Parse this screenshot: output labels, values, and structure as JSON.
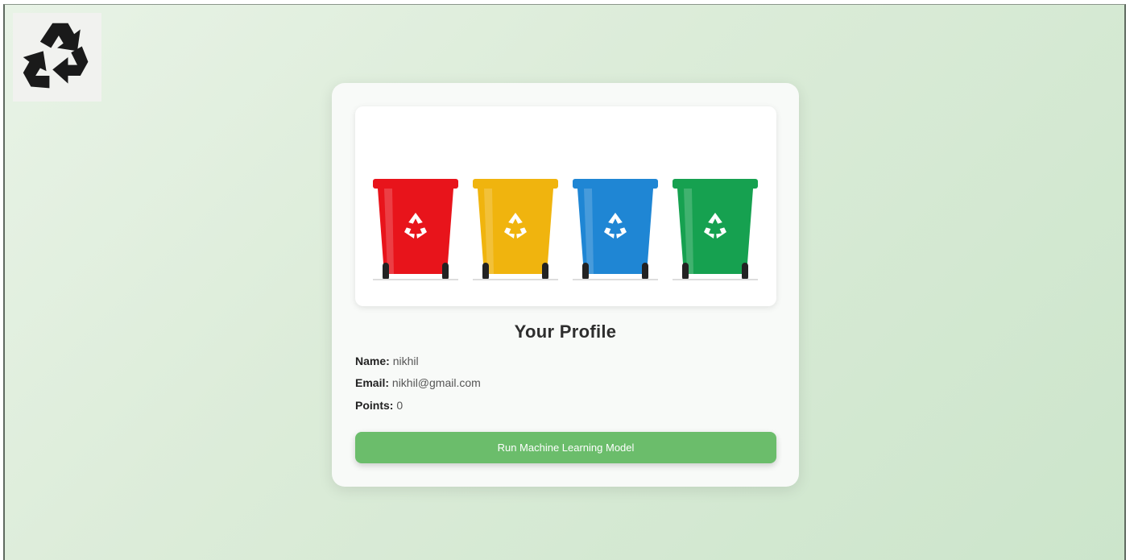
{
  "logo": {
    "icon": "recycle-icon"
  },
  "hero": {
    "bins": [
      {
        "color": "#e8141b",
        "icon": "recycle-icon"
      },
      {
        "color": "#f0b40e",
        "icon": "recycle-icon"
      },
      {
        "color": "#1f86d4",
        "icon": "recycle-icon"
      },
      {
        "color": "#16a150",
        "icon": "recycle-icon"
      }
    ]
  },
  "profile": {
    "title": "Your Profile",
    "name_label": "Name:",
    "name_value": "nikhil",
    "email_label": "Email:",
    "email_value": "nikhil@gmail.com",
    "points_label": "Points:",
    "points_value": "0"
  },
  "actions": {
    "run_model_label": "Run Machine Learning Model"
  },
  "colors": {
    "accent": "#6bbd6b",
    "background": "#dcecd9"
  }
}
